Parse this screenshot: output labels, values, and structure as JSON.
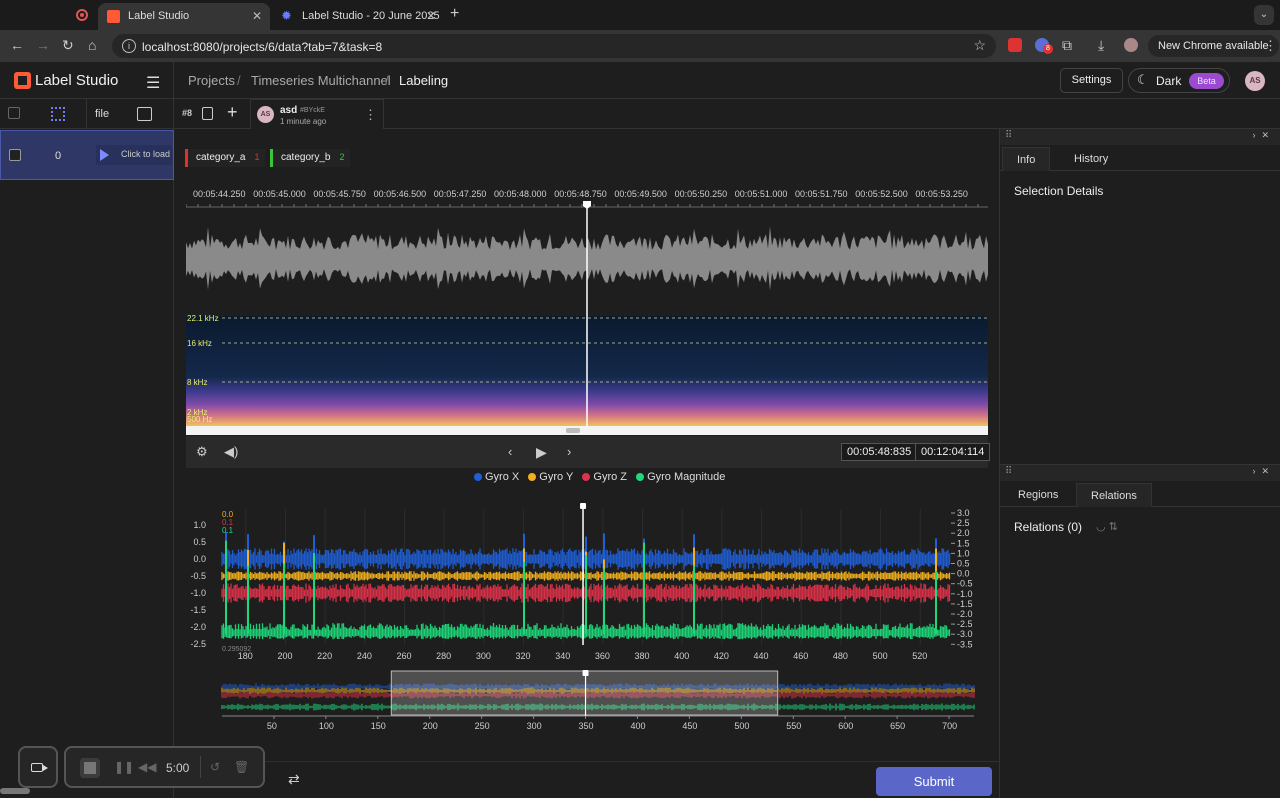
{
  "browser": {
    "tabs": [
      {
        "title": "Label Studio",
        "active": true
      },
      {
        "title": "Label Studio - 20 June 2025",
        "active": false
      }
    ],
    "url": "localhost:8080/projects/6/data?tab=7&task=8",
    "update_label": "New Chrome available",
    "extension_badge": "8"
  },
  "app": {
    "name": "Label Studio",
    "breadcrumb": [
      "Projects",
      "Timeseries Multichannel",
      "Labeling"
    ],
    "settings_label": "Settings",
    "theme_label": "Dark",
    "beta_label": "Beta",
    "user_initials": "AS"
  },
  "datalist": {
    "column_file": "file",
    "rows": [
      {
        "id": "0",
        "action": "Click to load"
      }
    ]
  },
  "annotation": {
    "task_id": "#8",
    "user": "asd",
    "annotation_hash": "#BYckE",
    "time_ago": "1 minute ago",
    "user_initials": "AS"
  },
  "labels": [
    {
      "name": "category_a",
      "hotkey": "1",
      "color": "#e0312e"
    },
    {
      "name": "category_b",
      "hotkey": "2",
      "color": "#3ac43a"
    }
  ],
  "audio": {
    "timeline_ticks": [
      "00:05:44.250",
      "00:05:45.000",
      "00:05:45.750",
      "00:05:46.500",
      "00:05:47.250",
      "00:05:48.000",
      "00:05:48.750",
      "00:05:49.500",
      "00:05:50.250",
      "00:05:51.000",
      "00:05:51.750",
      "00:05:52.500",
      "00:05:53.250"
    ],
    "spectrogram_labels": [
      "22.1 kHz",
      "16 kHz",
      "8 kHz",
      "2 kHz",
      "500 Hz"
    ],
    "current_time": "00:05:48:835",
    "duration": "00:12:04:114"
  },
  "chart_data": {
    "type": "line",
    "series": [
      {
        "name": "Gyro X",
        "color": "#1f5fd6"
      },
      {
        "name": "Gyro Y",
        "color": "#f2b01e"
      },
      {
        "name": "Gyro Z",
        "color": "#e0314a"
      },
      {
        "name": "Gyro Magnitude",
        "color": "#1ed97a"
      }
    ],
    "left_ticks": [
      "1.0",
      "0.5",
      "0.0",
      "-0.5",
      "-1.0",
      "-1.5",
      "-2.0",
      "-2.5"
    ],
    "right_ticks": [
      "3.0",
      "2.5",
      "2.0",
      "1.5",
      "1.0",
      "0.5",
      "0.0",
      "-0.5",
      "-1.0",
      "-1.5",
      "-2.0",
      "-2.5",
      "-3.0",
      "-3.5"
    ],
    "x_ticks": [
      "180",
      "200",
      "220",
      "240",
      "260",
      "280",
      "300",
      "320",
      "340",
      "360",
      "380",
      "400",
      "420",
      "440",
      "460",
      "480",
      "500",
      "520"
    ],
    "overview_x_ticks": [
      "50",
      "100",
      "150",
      "200",
      "250",
      "300",
      "350",
      "400",
      "450",
      "500",
      "550",
      "600",
      "650",
      "700"
    ],
    "tooltip_values": [
      "0.0",
      "0.1",
      "0.1"
    ],
    "bottom_label": "0.295092",
    "cursor_x": 350,
    "overview_window": [
      163,
      535
    ]
  },
  "footer": {
    "submit_label": "Submit"
  },
  "recorder": {
    "time": "5:00"
  },
  "right_panel": {
    "top_tabs": [
      "Info",
      "History"
    ],
    "top_title": "Selection Details",
    "bottom_tabs": [
      "Regions",
      "Relations"
    ],
    "relations_title": "Relations (0)"
  }
}
